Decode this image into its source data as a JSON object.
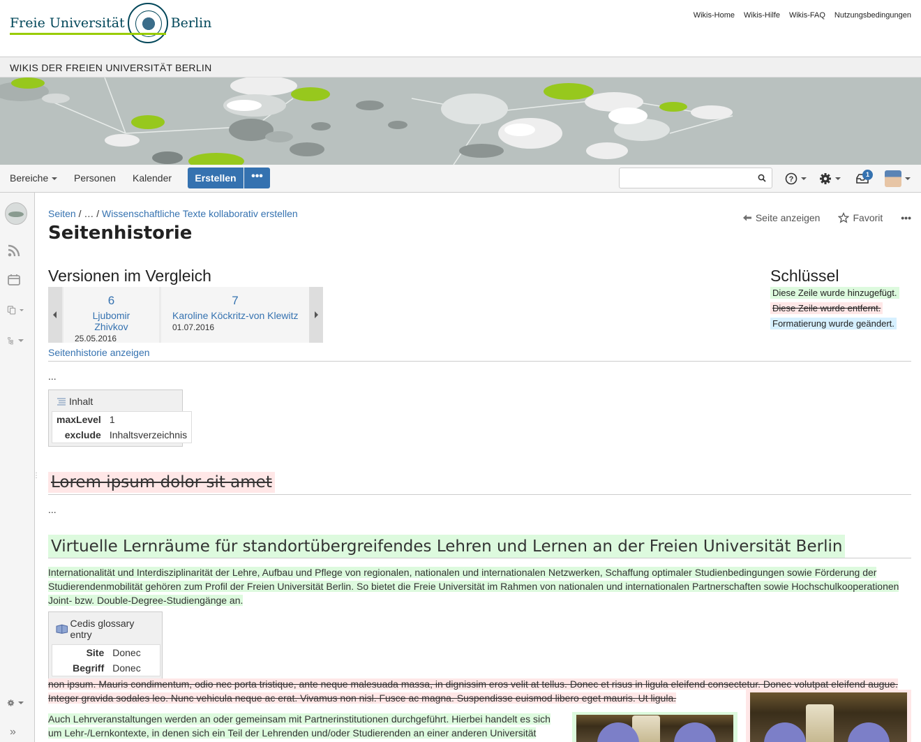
{
  "header": {
    "logo_left": "Freie Universität",
    "logo_right": "Berlin",
    "links": [
      "Wikis-Home",
      "Wikis-Hilfe",
      "Wikis-FAQ",
      "Nutzungsbedingungen"
    ]
  },
  "title_bar": "WIKIS DER FREIEN UNIVERSITÄT BERLIN",
  "navbar": {
    "bereiche": "Bereiche",
    "personen": "Personen",
    "kalender": "Kalender",
    "erstellen": "Erstellen",
    "more": "•••",
    "search_placeholder": "",
    "notifications_count": "1"
  },
  "breadcrumb": {
    "root": "Seiten",
    "ellipsis": "…",
    "parent": "Wissenschaftliche Texte kollaborativ erstellen",
    "sep": "/"
  },
  "page_title": "Seitenhistorie",
  "page_actions": {
    "view": "Seite anzeigen",
    "favorite": "Favorit",
    "more": "•••"
  },
  "comparison": {
    "heading": "Versionen im Vergleich",
    "versions": [
      {
        "number": "6",
        "author": "Ljubomir Zhivkov",
        "date": "25.05.2016"
      },
      {
        "number": "7",
        "author": "Karoline Köckritz-von Klewitz",
        "date": "01.07.2016"
      }
    ],
    "history_link": "Seitenhistorie anzeigen"
  },
  "key": {
    "heading": "Schlüssel",
    "added": "Diese Zeile wurde hinzugefügt.",
    "removed": "Diese Zeile wurde entfernt.",
    "formatted": "Formatierung wurde geändert."
  },
  "diff": {
    "ellipsis1": "...",
    "toc_macro": {
      "title": "Inhalt",
      "params": [
        {
          "key": "maxLevel",
          "value": "1"
        },
        {
          "key": "exclude",
          "value": "Inhaltsverzeichnis"
        }
      ]
    },
    "removed_heading": "Lorem ipsum dolor sit amet",
    "ellipsis2": "...",
    "added_heading": "Virtuelle Lernräume für standortübergreifendes Lehren und Lernen an der Freien Universität Berlin",
    "added_paragraph": " Internationalität und Interdisziplinarität der Lehre, Aufbau und Pflege von regionalen, nationalen und internationalen Netzwerken, Schaffung optimaler Studienbedingungen sowie Förderung der Studierendenmobilität gehören zum Profil der Freien Universität Berlin. So bietet die Freie Universität im Rahmen von nationalen und internationalen Partnerschaften sowie Hochschulkooperationen Joint- bzw. Double-Degree-Studiengänge an. ",
    "glossary_macro": {
      "title": "Cedis glossary entry",
      "params": [
        {
          "key": "Site",
          "value": "Donec"
        },
        {
          "key": "Begriff",
          "value": "Donec"
        }
      ]
    },
    "removed_paragraph": "  non ipsum. Mauris condimentum, odio nec porta tristique, ante neque malesuada massa, in dignissim eros velit at tellus. Donec et risus in ligula eleifend consectetur. Donec volutpat eleifend augue. Integer gravida sodales leo. Nunc vehicula neque ac erat. Vivamus non nisl. Fusce ac magna. Suspendisse euismod libero eget mauris.  Ut ligula. ",
    "added_paragraph2": " Auch Lehrveranstaltungen werden an oder gemeinsam mit Partnerinstitutionen durchgeführt. Hierbei handelt es sich um Lehr-/Lernkontexte, in denen sich ein Teil der Lehrenden und/oder Studierenden an einer anderen Universität"
  },
  "colors": {
    "accent": "#3572b0",
    "fu_green": "#99cc00",
    "added_bg": "#ddfade",
    "removed_bg": "#ffe7e7",
    "formatted_bg": "#d6f0ff"
  }
}
